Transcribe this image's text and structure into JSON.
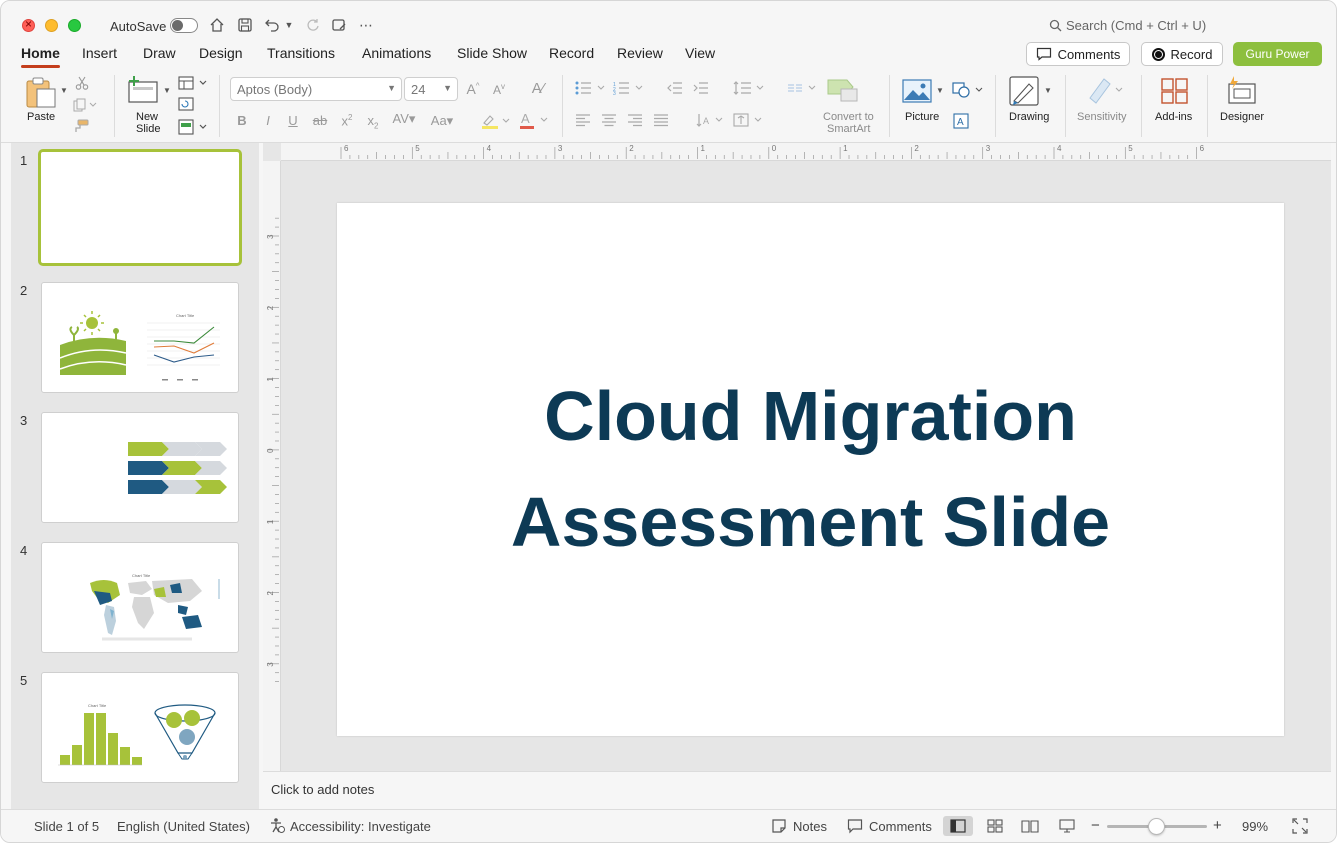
{
  "titlebar": {
    "autosave_label": "AutoSave",
    "search_placeholder": "Search (Cmd + Ctrl + U)"
  },
  "tabs": [
    "Home",
    "Insert",
    "Draw",
    "Design",
    "Transitions",
    "Animations",
    "Slide Show",
    "Record",
    "Review",
    "View"
  ],
  "actions": {
    "comments": "Comments",
    "record": "Record",
    "guru": "Guru Power"
  },
  "ribbon": {
    "paste": "Paste",
    "new_slide_1": "New",
    "new_slide_2": "Slide",
    "font_name": "Aptos (Body)",
    "font_size": "24",
    "convert_1": "Convert to",
    "convert_2": "SmartArt",
    "picture": "Picture",
    "drawing": "Drawing",
    "sensitivity": "Sensitivity",
    "addins": "Add-ins",
    "designer": "Designer"
  },
  "slides": [
    {
      "num": "1"
    },
    {
      "num": "2"
    },
    {
      "num": "3"
    },
    {
      "num": "4"
    },
    {
      "num": "5"
    }
  ],
  "ruler_h": [
    "6",
    "5",
    "4",
    "3",
    "2",
    "1",
    "0",
    "1",
    "2",
    "3",
    "4",
    "5",
    "6"
  ],
  "ruler_v": [
    "3",
    "2",
    "1",
    "0",
    "1",
    "2",
    "3"
  ],
  "slide": {
    "title_line1": "Cloud Migration",
    "title_line2": "Assessment Slide"
  },
  "notes_placeholder": "Click to add notes",
  "status": {
    "slide_info": "Slide 1 of 5",
    "language": "English (United States)",
    "accessibility": "Accessibility: Investigate",
    "notes": "Notes",
    "comments": "Comments",
    "zoom": "99%"
  },
  "colors": {
    "accent_green": "#8dbf3e",
    "title_navy": "#0d3a55",
    "tab_underline": "#c43e1c"
  }
}
